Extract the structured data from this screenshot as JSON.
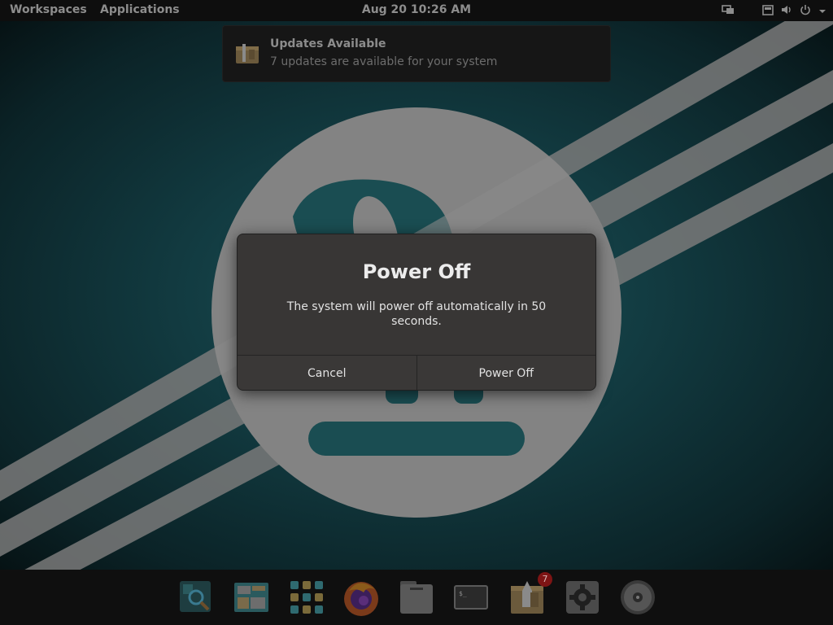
{
  "topbar": {
    "workspaces": "Workspaces",
    "applications": "Applications",
    "clock": "Aug 20  10:26 AM"
  },
  "notification": {
    "title": "Updates Available",
    "body": "7 updates are available for your system"
  },
  "dialog": {
    "title": "Power Off",
    "message": "The system will power off automatically in 50 seconds.",
    "cancel_label": "Cancel",
    "confirm_label": "Power Off"
  },
  "dock": {
    "items": [
      {
        "name": "search-icon"
      },
      {
        "name": "workspaces-icon"
      },
      {
        "name": "app-grid-icon"
      },
      {
        "name": "firefox-icon"
      },
      {
        "name": "files-icon"
      },
      {
        "name": "terminal-icon"
      },
      {
        "name": "store-icon"
      },
      {
        "name": "settings-icon"
      },
      {
        "name": "optical-disc-icon"
      }
    ],
    "store_badge": "7"
  },
  "colors": {
    "wallpaper_teal": "#1d5257",
    "dialog_bg": "#383635",
    "badge": "#7e1414"
  }
}
